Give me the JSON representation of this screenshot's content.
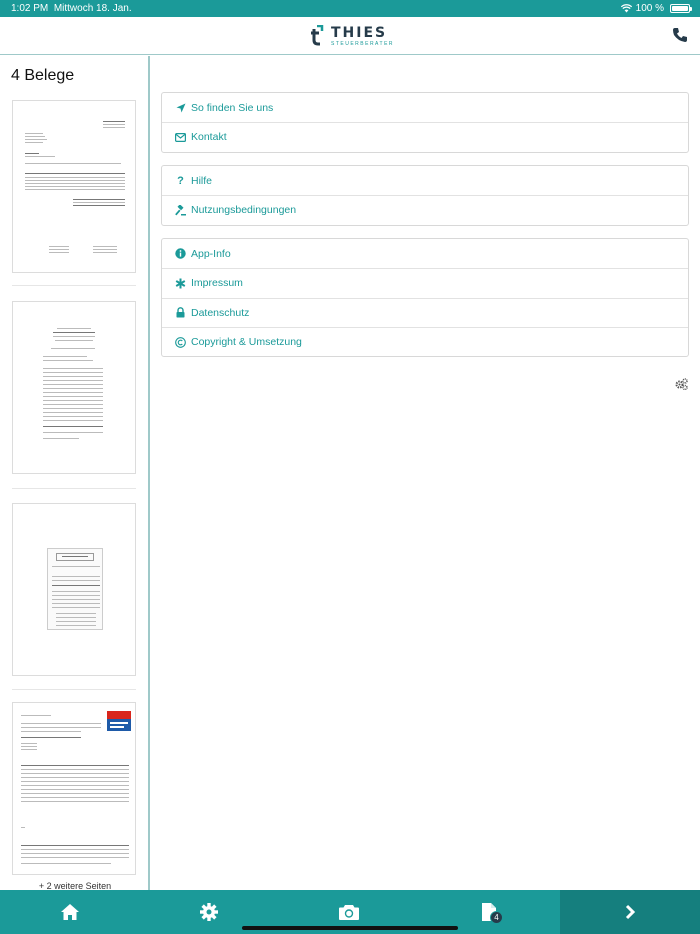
{
  "status_bar": {
    "time": "1:02 PM",
    "date": "Mittwoch 18. Jan.",
    "battery": "100 %"
  },
  "header": {
    "brand_name": "THIES",
    "brand_sub": "STEUERBERATER"
  },
  "left_panel": {
    "title": "4 Belege",
    "documents": [
      {
        "kind": "invoice"
      },
      {
        "kind": "receipt"
      },
      {
        "kind": "receipt"
      },
      {
        "kind": "invoice",
        "brand": "BOSCH Service"
      }
    ],
    "more_pages": "+ 2 weitere Seiten"
  },
  "menu": {
    "groups": [
      [
        {
          "label": "So finden Sie uns",
          "icon": "location-arrow-icon"
        },
        {
          "label": "Kontakt",
          "icon": "envelope-icon"
        }
      ],
      [
        {
          "label": "Hilfe",
          "icon": "question-icon"
        },
        {
          "label": "Nutzungsbedingungen",
          "icon": "gavel-icon"
        }
      ],
      [
        {
          "label": "App-Info",
          "icon": "info-circle-icon"
        },
        {
          "label": "Impressum",
          "icon": "asterisk-icon"
        },
        {
          "label": "Datenschutz",
          "icon": "lock-icon"
        },
        {
          "label": "Copyright & Umsetzung",
          "icon": "copyright-icon"
        }
      ]
    ]
  },
  "bottom_bar": {
    "tabs": [
      "home-icon",
      "gear-icon",
      "camera-icon",
      "documents-icon"
    ],
    "documents_badge": "4"
  },
  "colors": {
    "accent": "#1b9a99",
    "accent_dark": "#157f7e",
    "brand_dark": "#263b4a"
  }
}
